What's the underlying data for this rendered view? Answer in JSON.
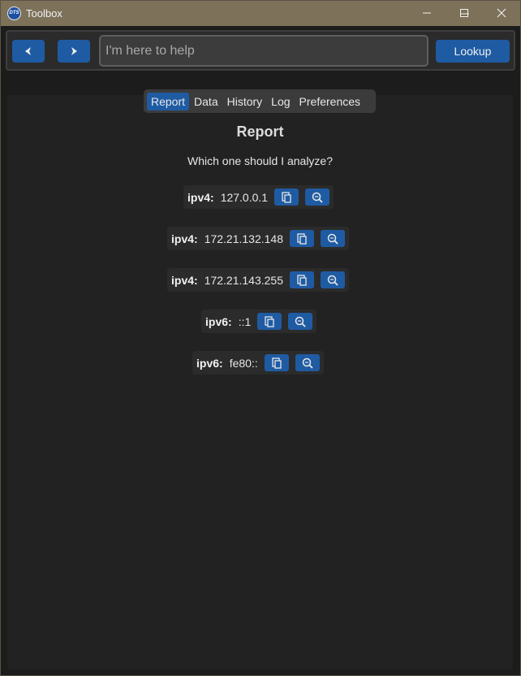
{
  "window": {
    "title": "Toolbox",
    "logo_text": "DTS"
  },
  "toolbar": {
    "back_icon": "back-arrow-icon",
    "forward_icon": "forward-arrow-icon",
    "search_placeholder": "I'm here to help",
    "lookup_label": "Lookup"
  },
  "tabs": [
    {
      "label": "Report",
      "active": true
    },
    {
      "label": "Data",
      "active": false
    },
    {
      "label": "History",
      "active": false
    },
    {
      "label": "Log",
      "active": false
    },
    {
      "label": "Preferences",
      "active": false
    }
  ],
  "report": {
    "title": "Report",
    "question": "Which one should I analyze?",
    "items": [
      {
        "type": "ipv4:",
        "value": "127.0.0.1"
      },
      {
        "type": "ipv4:",
        "value": "172.21.132.148"
      },
      {
        "type": "ipv4:",
        "value": "172.21.143.255"
      },
      {
        "type": "ipv6:",
        "value": "::1"
      },
      {
        "type": "ipv6:",
        "value": "fe80::"
      }
    ]
  },
  "colors": {
    "accent": "#1f5ba3",
    "titlebar": "#7d7159",
    "background": "#1c1c1c"
  }
}
